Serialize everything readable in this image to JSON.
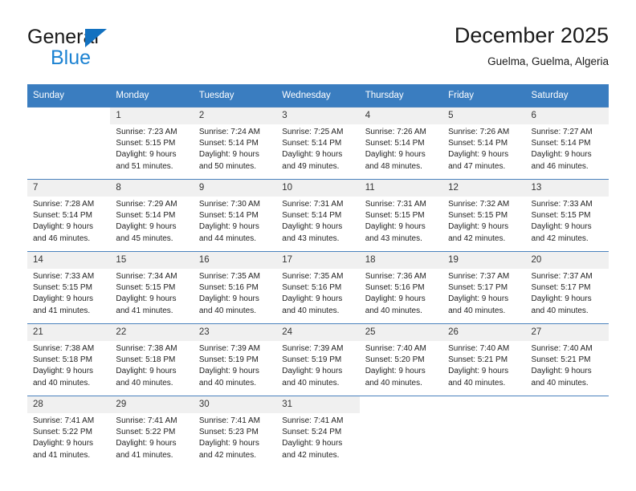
{
  "brand": {
    "name_part1": "General",
    "name_part2": "Blue",
    "accent_color": "#1b82d2",
    "triangle_color": "#1271c0"
  },
  "header": {
    "title": "December 2025",
    "subtitle": "Guelma, Guelma, Algeria"
  },
  "theme": {
    "header_row_bg": "#3a7dc0",
    "header_row_text": "#ffffff",
    "day_number_bg": "#f0f0f0",
    "grid_line": "#4a82bd"
  },
  "weekdays": [
    "Sunday",
    "Monday",
    "Tuesday",
    "Wednesday",
    "Thursday",
    "Friday",
    "Saturday"
  ],
  "weeks": [
    [
      {
        "day": "",
        "sunrise": "",
        "sunset": "",
        "daylight1": "",
        "daylight2": ""
      },
      {
        "day": "1",
        "sunrise": "Sunrise: 7:23 AM",
        "sunset": "Sunset: 5:15 PM",
        "daylight1": "Daylight: 9 hours",
        "daylight2": "and 51 minutes."
      },
      {
        "day": "2",
        "sunrise": "Sunrise: 7:24 AM",
        "sunset": "Sunset: 5:14 PM",
        "daylight1": "Daylight: 9 hours",
        "daylight2": "and 50 minutes."
      },
      {
        "day": "3",
        "sunrise": "Sunrise: 7:25 AM",
        "sunset": "Sunset: 5:14 PM",
        "daylight1": "Daylight: 9 hours",
        "daylight2": "and 49 minutes."
      },
      {
        "day": "4",
        "sunrise": "Sunrise: 7:26 AM",
        "sunset": "Sunset: 5:14 PM",
        "daylight1": "Daylight: 9 hours",
        "daylight2": "and 48 minutes."
      },
      {
        "day": "5",
        "sunrise": "Sunrise: 7:26 AM",
        "sunset": "Sunset: 5:14 PM",
        "daylight1": "Daylight: 9 hours",
        "daylight2": "and 47 minutes."
      },
      {
        "day": "6",
        "sunrise": "Sunrise: 7:27 AM",
        "sunset": "Sunset: 5:14 PM",
        "daylight1": "Daylight: 9 hours",
        "daylight2": "and 46 minutes."
      }
    ],
    [
      {
        "day": "7",
        "sunrise": "Sunrise: 7:28 AM",
        "sunset": "Sunset: 5:14 PM",
        "daylight1": "Daylight: 9 hours",
        "daylight2": "and 46 minutes."
      },
      {
        "day": "8",
        "sunrise": "Sunrise: 7:29 AM",
        "sunset": "Sunset: 5:14 PM",
        "daylight1": "Daylight: 9 hours",
        "daylight2": "and 45 minutes."
      },
      {
        "day": "9",
        "sunrise": "Sunrise: 7:30 AM",
        "sunset": "Sunset: 5:14 PM",
        "daylight1": "Daylight: 9 hours",
        "daylight2": "and 44 minutes."
      },
      {
        "day": "10",
        "sunrise": "Sunrise: 7:31 AM",
        "sunset": "Sunset: 5:14 PM",
        "daylight1": "Daylight: 9 hours",
        "daylight2": "and 43 minutes."
      },
      {
        "day": "11",
        "sunrise": "Sunrise: 7:31 AM",
        "sunset": "Sunset: 5:15 PM",
        "daylight1": "Daylight: 9 hours",
        "daylight2": "and 43 minutes."
      },
      {
        "day": "12",
        "sunrise": "Sunrise: 7:32 AM",
        "sunset": "Sunset: 5:15 PM",
        "daylight1": "Daylight: 9 hours",
        "daylight2": "and 42 minutes."
      },
      {
        "day": "13",
        "sunrise": "Sunrise: 7:33 AM",
        "sunset": "Sunset: 5:15 PM",
        "daylight1": "Daylight: 9 hours",
        "daylight2": "and 42 minutes."
      }
    ],
    [
      {
        "day": "14",
        "sunrise": "Sunrise: 7:33 AM",
        "sunset": "Sunset: 5:15 PM",
        "daylight1": "Daylight: 9 hours",
        "daylight2": "and 41 minutes."
      },
      {
        "day": "15",
        "sunrise": "Sunrise: 7:34 AM",
        "sunset": "Sunset: 5:15 PM",
        "daylight1": "Daylight: 9 hours",
        "daylight2": "and 41 minutes."
      },
      {
        "day": "16",
        "sunrise": "Sunrise: 7:35 AM",
        "sunset": "Sunset: 5:16 PM",
        "daylight1": "Daylight: 9 hours",
        "daylight2": "and 40 minutes."
      },
      {
        "day": "17",
        "sunrise": "Sunrise: 7:35 AM",
        "sunset": "Sunset: 5:16 PM",
        "daylight1": "Daylight: 9 hours",
        "daylight2": "and 40 minutes."
      },
      {
        "day": "18",
        "sunrise": "Sunrise: 7:36 AM",
        "sunset": "Sunset: 5:16 PM",
        "daylight1": "Daylight: 9 hours",
        "daylight2": "and 40 minutes."
      },
      {
        "day": "19",
        "sunrise": "Sunrise: 7:37 AM",
        "sunset": "Sunset: 5:17 PM",
        "daylight1": "Daylight: 9 hours",
        "daylight2": "and 40 minutes."
      },
      {
        "day": "20",
        "sunrise": "Sunrise: 7:37 AM",
        "sunset": "Sunset: 5:17 PM",
        "daylight1": "Daylight: 9 hours",
        "daylight2": "and 40 minutes."
      }
    ],
    [
      {
        "day": "21",
        "sunrise": "Sunrise: 7:38 AM",
        "sunset": "Sunset: 5:18 PM",
        "daylight1": "Daylight: 9 hours",
        "daylight2": "and 40 minutes."
      },
      {
        "day": "22",
        "sunrise": "Sunrise: 7:38 AM",
        "sunset": "Sunset: 5:18 PM",
        "daylight1": "Daylight: 9 hours",
        "daylight2": "and 40 minutes."
      },
      {
        "day": "23",
        "sunrise": "Sunrise: 7:39 AM",
        "sunset": "Sunset: 5:19 PM",
        "daylight1": "Daylight: 9 hours",
        "daylight2": "and 40 minutes."
      },
      {
        "day": "24",
        "sunrise": "Sunrise: 7:39 AM",
        "sunset": "Sunset: 5:19 PM",
        "daylight1": "Daylight: 9 hours",
        "daylight2": "and 40 minutes."
      },
      {
        "day": "25",
        "sunrise": "Sunrise: 7:40 AM",
        "sunset": "Sunset: 5:20 PM",
        "daylight1": "Daylight: 9 hours",
        "daylight2": "and 40 minutes."
      },
      {
        "day": "26",
        "sunrise": "Sunrise: 7:40 AM",
        "sunset": "Sunset: 5:21 PM",
        "daylight1": "Daylight: 9 hours",
        "daylight2": "and 40 minutes."
      },
      {
        "day": "27",
        "sunrise": "Sunrise: 7:40 AM",
        "sunset": "Sunset: 5:21 PM",
        "daylight1": "Daylight: 9 hours",
        "daylight2": "and 40 minutes."
      }
    ],
    [
      {
        "day": "28",
        "sunrise": "Sunrise: 7:41 AM",
        "sunset": "Sunset: 5:22 PM",
        "daylight1": "Daylight: 9 hours",
        "daylight2": "and 41 minutes."
      },
      {
        "day": "29",
        "sunrise": "Sunrise: 7:41 AM",
        "sunset": "Sunset: 5:22 PM",
        "daylight1": "Daylight: 9 hours",
        "daylight2": "and 41 minutes."
      },
      {
        "day": "30",
        "sunrise": "Sunrise: 7:41 AM",
        "sunset": "Sunset: 5:23 PM",
        "daylight1": "Daylight: 9 hours",
        "daylight2": "and 42 minutes."
      },
      {
        "day": "31",
        "sunrise": "Sunrise: 7:41 AM",
        "sunset": "Sunset: 5:24 PM",
        "daylight1": "Daylight: 9 hours",
        "daylight2": "and 42 minutes."
      },
      {
        "day": "",
        "sunrise": "",
        "sunset": "",
        "daylight1": "",
        "daylight2": ""
      },
      {
        "day": "",
        "sunrise": "",
        "sunset": "",
        "daylight1": "",
        "daylight2": ""
      },
      {
        "day": "",
        "sunrise": "",
        "sunset": "",
        "daylight1": "",
        "daylight2": ""
      }
    ]
  ]
}
